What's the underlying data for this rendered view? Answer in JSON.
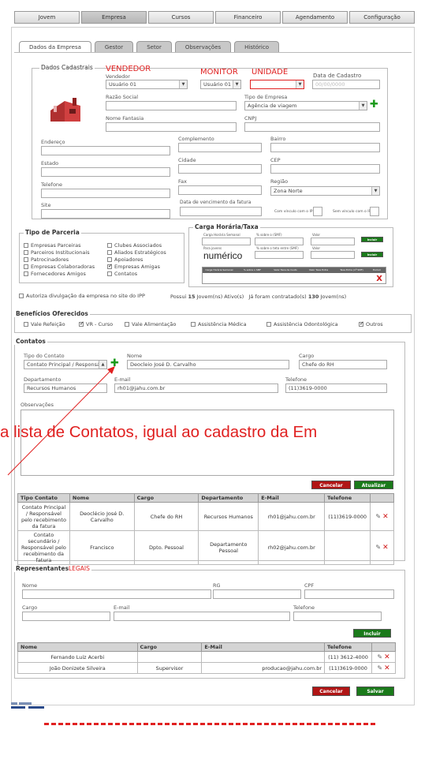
{
  "nav": [
    "Jovem",
    "Empresa",
    "Cursos",
    "Financeiro",
    "Agendamento",
    "Configuração"
  ],
  "tabs": [
    "Dados da Empresa",
    "Gestor",
    "Setor",
    "Observações",
    "Histórico"
  ],
  "dados": {
    "legend": "Dados Cadastrais",
    "annot_vendedor": "VENDEDOR",
    "annot_monitor": "MONITOR",
    "annot_unidade": "UNIDADE",
    "lbl_vendedor": "Vendedor",
    "vendedor_value": "Usuário 01",
    "monitor_value": "Usuário 01",
    "unidade_value": "",
    "lbl_data_cadastro": "Data de Cadastro",
    "data_cadastro_placeholder": "00/00/0000",
    "lbl_razao": "Razão Social",
    "lbl_tipo": "Tipo de Empresa",
    "tipo_value": "Agência de viagem",
    "lbl_fantasia": "Nome Fantasia",
    "lbl_cnpj": "CNPJ",
    "lbl_endereco": "Endereço",
    "lbl_complemento": "Complemento",
    "lbl_bairro": "Bairro",
    "lbl_estado": "Estado",
    "lbl_cidade": "Cidade",
    "lbl_cep": "CEP",
    "lbl_telefone": "Telefone",
    "lbl_fax": "Fax",
    "lbl_regiao": "Região",
    "regiao_value": "Zona Norte",
    "lbl_site": "Site",
    "lbl_vencimento": "Data de vencimento da fatura",
    "lbl_com_vinculo": "Com vínculo com o IPP",
    "lbl_sem_vinculo": "Sem vínculo com o IPP"
  },
  "parceria": {
    "legend": "Tipo de Parceria",
    "col1": [
      "Empresas Parceiras",
      "Parceiros Institucionais",
      "Patrocinadores",
      "Empresas Colaboradoras",
      "Fornecedores Amigos"
    ],
    "col2": [
      "Clubes Associados",
      "Aliados Estratégicos",
      "Apoiadores",
      "Empresas Amigas",
      "Contatos"
    ],
    "checked": [
      "Empresas Amigas"
    ]
  },
  "carga": {
    "legend": "Carga Horária/Taxa",
    "annot": "numérico",
    "r1": [
      "Carga Horária Semanal",
      "% sobre o (SMF)",
      "Valor"
    ],
    "r2": [
      "Para jovens",
      "% sobre o teto entre (SMF)",
      "Valor"
    ],
    "btn": "Incluir",
    "headers": [
      "Carga Horária Semanal",
      "% sobre o SMF",
      "Valor Taxa de Custo",
      "Valor Taxa Extra",
      "Taxa Extra (1ª SMF)",
      "Excluir"
    ]
  },
  "autoriza": {
    "label": "Autoriza divulgação da empresa no site do IPP",
    "possui": "Possui",
    "n_ativos": "15",
    "ativos_text": "Jovem(ns) Ativo(s)",
    "ja": "Já foram contratado(s)",
    "n_contratados": "130",
    "contratados_text": "Jovem(ns)"
  },
  "beneficios": {
    "legend": "Benefícios Oferecidos",
    "items": [
      "Vale Refeição",
      "VR - Curso",
      "Vale Alimentação",
      "Assistência Médica",
      "Assistência Odontológica",
      "Outros"
    ],
    "checked": [
      "VR - Curso",
      "Outros"
    ]
  },
  "contatos": {
    "legend": "Contatos",
    "lbl_tipo": "Tipo do Contato",
    "tipo_value": "Contato Principal / Responsável",
    "lbl_nome": "Nome",
    "nome_value": "Deocleio José D. Carvalho",
    "lbl_cargo": "Cargo",
    "cargo_value": "Chefe do RH",
    "lbl_depto": "Departamento",
    "depto_value": "Recursos Humanos",
    "lbl_email": "E-mail",
    "email_value": "rh01@jahu.com.br",
    "lbl_telefone": "Telefone",
    "telefone_value": "(11)3619-0000",
    "lbl_obs": "Observações",
    "overlay": "a lista de Contatos, igual ao cadastro da Em",
    "btn_cancelar": "Cancelar",
    "btn_atualizar": "Atualizar",
    "headers": [
      "Tipo Contato",
      "Nome",
      "Cargo",
      "Departamento",
      "E-Mail",
      "Telefone"
    ],
    "rows": [
      {
        "tipo": "Contato Principal / Responsável pelo recebimento da fatura",
        "nome": "Deoclécio José D. Carvalho",
        "cargo": "Chefe do RH",
        "depto": "Recursos Humanos",
        "email": "rh01@jahu.com.br",
        "tel": "(11)3619-0000"
      },
      {
        "tipo": "Contato secundário / Responsável pelo recebimento da fatura",
        "nome": "Francisco",
        "cargo": "Dpto. Pessoal",
        "depto": "Departamento Pessoal",
        "email": "rh02@jahu.com.br",
        "tel": ""
      }
    ]
  },
  "representantes": {
    "legend": "Representantes",
    "annot": "LEGAIS",
    "lbl_nome": "Nome",
    "lbl_rg": "RG",
    "lbl_cpf": "CPF",
    "lbl_cargo": "Cargo",
    "lbl_email": "E-mail",
    "lbl_telefone": "Telefone",
    "btn_incluir": "Incluir",
    "headers": [
      "Nome",
      "Cargo",
      "E-Mail",
      "Telefone"
    ],
    "rows": [
      {
        "nome": "Fernando Luiz Acerbi",
        "cargo": "",
        "email": "",
        "tel": "(11) 3612-4000"
      },
      {
        "nome": "João Donizete Silveira",
        "cargo": "Supervisor",
        "email": "producao@jahu.com.br",
        "tel": "(11)3619-0000"
      }
    ]
  },
  "footer": {
    "btn_cancelar": "Cancelar",
    "btn_salvar": "Salvar"
  }
}
